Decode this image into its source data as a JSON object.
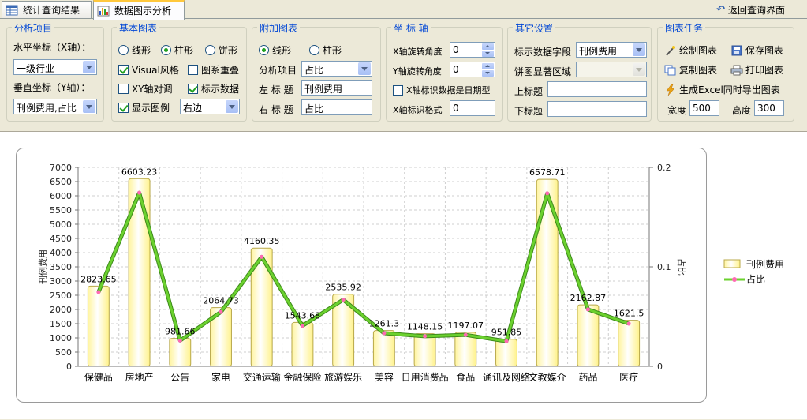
{
  "tabs": [
    {
      "label": "统计查询结果",
      "icon": "table-icon"
    },
    {
      "label": "数据图示分析",
      "icon": "bar-chart-icon"
    }
  ],
  "back_label": "返回查询界面",
  "analysis": {
    "legend": "分析项目",
    "x_label": "水平坐标（X轴）：",
    "x_value": "一级行业",
    "y_label": "垂直坐标（Y轴）：",
    "y_value": "刊例费用,占比"
  },
  "basic": {
    "legend": "基本图表",
    "radio_line": "线形",
    "radio_bar": "柱形",
    "radio_pie": "饼形",
    "visual_style": "Visual风格",
    "overlay": "图系重叠",
    "swap_xy": "XY轴对调",
    "show_data": "标示数据",
    "show_legend": "显示图例",
    "legend_position": "右边"
  },
  "extra": {
    "legend": "附加图表",
    "radio_line": "线形",
    "radio_bar": "柱形",
    "item_label": "分析项目",
    "item_value": "占比",
    "left_title_label": "左 标 题",
    "left_title_value": "刊例费用",
    "right_title_label": "右 标 题",
    "right_title_value": "占比"
  },
  "axis": {
    "legend": "坐 标 轴",
    "x_rotate_label": "X轴旋转角度",
    "x_rotate_value": "0",
    "y_rotate_label": "Y轴旋转角度",
    "y_rotate_value": "0",
    "x_is_date": "X轴标识数据是日期型",
    "x_format_label": "X轴标识格式",
    "x_format_value": "0"
  },
  "other": {
    "legend": "其它设置",
    "data_field_label": "标示数据字段",
    "data_field_value": "刊例费用",
    "pie_area_label": "饼图显著区域",
    "pie_area_value": "",
    "top_title_label": "上标题",
    "top_title_value": "",
    "bottom_title_label": "下标题",
    "bottom_title_value": ""
  },
  "task": {
    "legend": "图表任务",
    "draw": "绘制图表",
    "save": "保存图表",
    "copy": "复制图表",
    "print": "打印图表",
    "excel": "生成Excel同时导出图表",
    "width_label": "宽度",
    "width_value": "500",
    "height_label": "高度",
    "height_value": "300"
  },
  "colors": {
    "accent": "#0046d5",
    "bar_fill_top": "#ffffff",
    "bar_fill_bottom": "#fff49e",
    "line_green": "#6bd12e",
    "line_marker": "#ff69b4"
  },
  "chart_data": {
    "type": "bar",
    "categories": [
      "保健品",
      "房地产",
      "公告",
      "家电",
      "交通运输",
      "金融保险",
      "旅游娱乐",
      "美容",
      "日用消费品",
      "食品",
      "通讯及网络",
      "文教媒介",
      "药品",
      "医疗"
    ],
    "series": [
      {
        "name": "刊例费用",
        "type": "bar",
        "axis": "left",
        "values": [
          2823.65,
          6603.23,
          981.66,
          2064.73,
          4160.35,
          1543.68,
          2535.92,
          1261.3,
          1148.15,
          1197.07,
          951.85,
          6578.71,
          2162.87,
          1621.5
        ],
        "labels": [
          "2823.65",
          "6603.23",
          "981.66",
          "2064.73",
          "4160.35",
          "1543.68",
          "2535.92",
          "1261.3",
          "1148.15",
          "1197.07",
          "951.85",
          "6578.71",
          "2162.87",
          "1621.5"
        ]
      },
      {
        "name": "占比",
        "type": "line",
        "axis": "right",
        "values": [
          0.0746,
          0.1745,
          0.0259,
          0.0546,
          0.11,
          0.0408,
          0.067,
          0.0333,
          0.0303,
          0.0316,
          0.0252,
          0.1739,
          0.0572,
          0.0429
        ]
      }
    ],
    "y_label": "刊例费用",
    "y2_label": "占比",
    "ylim": [
      0,
      7000
    ],
    "yticks": [
      0,
      500,
      1000,
      1500,
      2000,
      2500,
      3000,
      3500,
      4000,
      4500,
      5000,
      5500,
      6000,
      6500,
      7000
    ],
    "y2lim": [
      0,
      0.2
    ],
    "y2ticks": [
      "0",
      "0.1",
      "0.2"
    ],
    "grid": true,
    "legend_position": "right"
  }
}
